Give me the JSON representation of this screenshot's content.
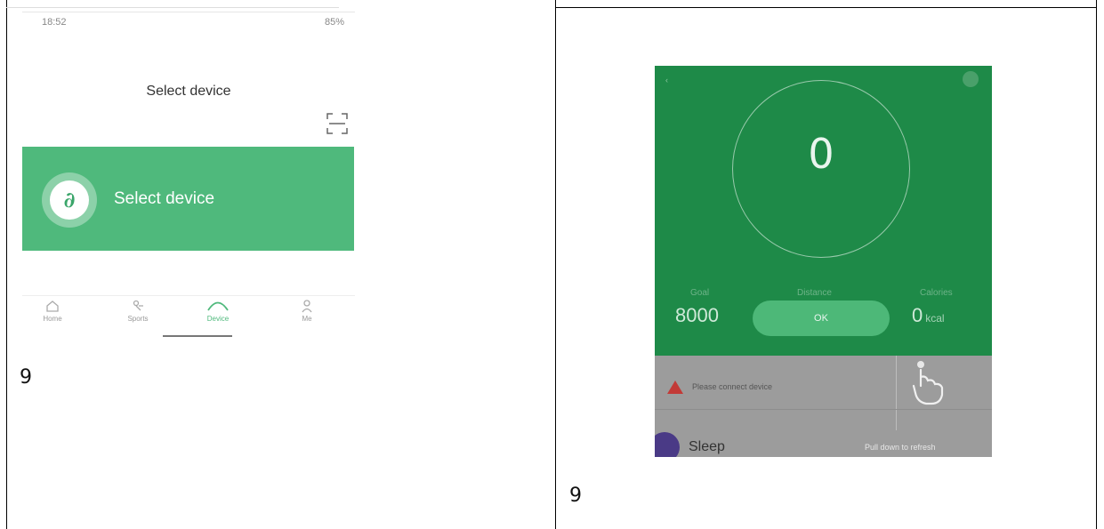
{
  "captions": {
    "left": "9",
    "right": "9"
  },
  "left_screen": {
    "status_time": "18:52",
    "status_right": "85%",
    "title": "Select device",
    "banner_label": "Select device",
    "logo_glyph": "∂",
    "nav": [
      {
        "label": "Home",
        "icon": "home-icon"
      },
      {
        "label": "Sports",
        "icon": "sports-icon"
      },
      {
        "label": "Device",
        "icon": "device-icon",
        "active": true
      },
      {
        "label": "Me",
        "icon": "person-icon"
      }
    ],
    "colors": {
      "accent": "#4fb97c"
    }
  },
  "right_screen": {
    "steps_count": "0",
    "goal_label": "Goal",
    "distance_label": "Distance",
    "calories_label": "Calories",
    "goal_value": "8000",
    "ok_label": "OK",
    "calories_value": "0",
    "calories_unit": "kcal",
    "connect_message": "Please connect device",
    "sleep_label": "Sleep",
    "pull_hint": "Pull down to refresh",
    "colors": {
      "green": "#1e8a48",
      "button": "#4db878",
      "warning": "#c23a37"
    }
  }
}
